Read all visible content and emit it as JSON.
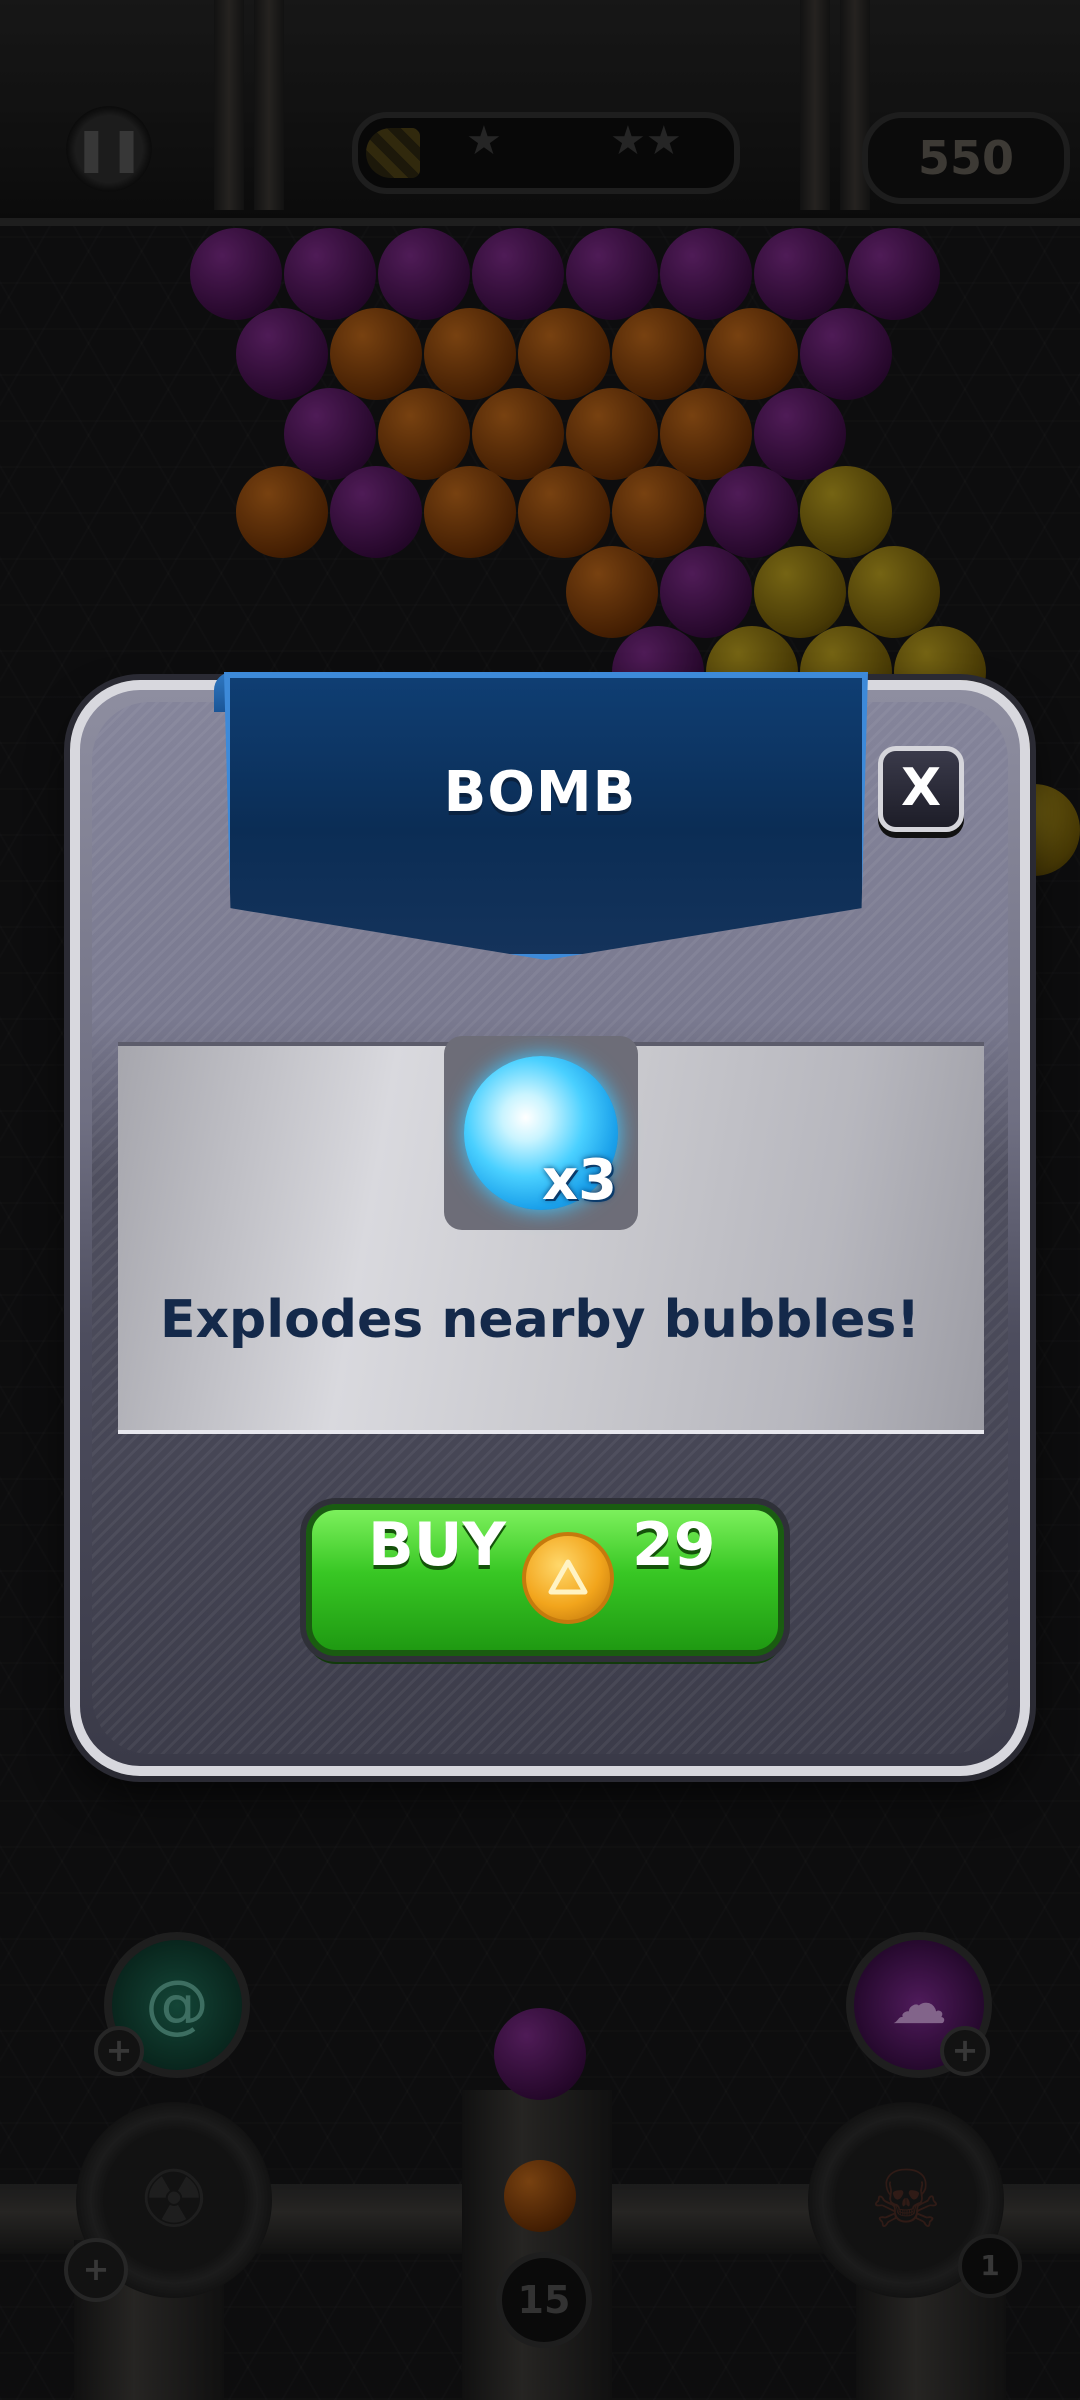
{
  "hud": {
    "pause_icon": "pause-icon",
    "stars": [
      "★",
      "★★"
    ],
    "star_progress": 0.15,
    "score": "550"
  },
  "board": {
    "colors": {
      "purple": "#5a1a66",
      "orange": "#8a4a10",
      "yellow": "#8c7612"
    }
  },
  "bottom": {
    "shots_left": "15",
    "right_powerup_count": "1",
    "plus_label": "+",
    "left_powerup_icon": "swirl-icon",
    "right_powerup_icon": "storm-icon",
    "left_tank_icon": "radiation-icon",
    "right_tank_icon": "skull-fire-icon"
  },
  "modal": {
    "title": "BOMB",
    "close_label": "X",
    "item_quantity": "x3",
    "description": "Explodes nearby bubbles!",
    "buy_label": "BUY",
    "price": "29",
    "accent_color": "#3fcf28",
    "ribbon_color": "#0f3e73"
  }
}
